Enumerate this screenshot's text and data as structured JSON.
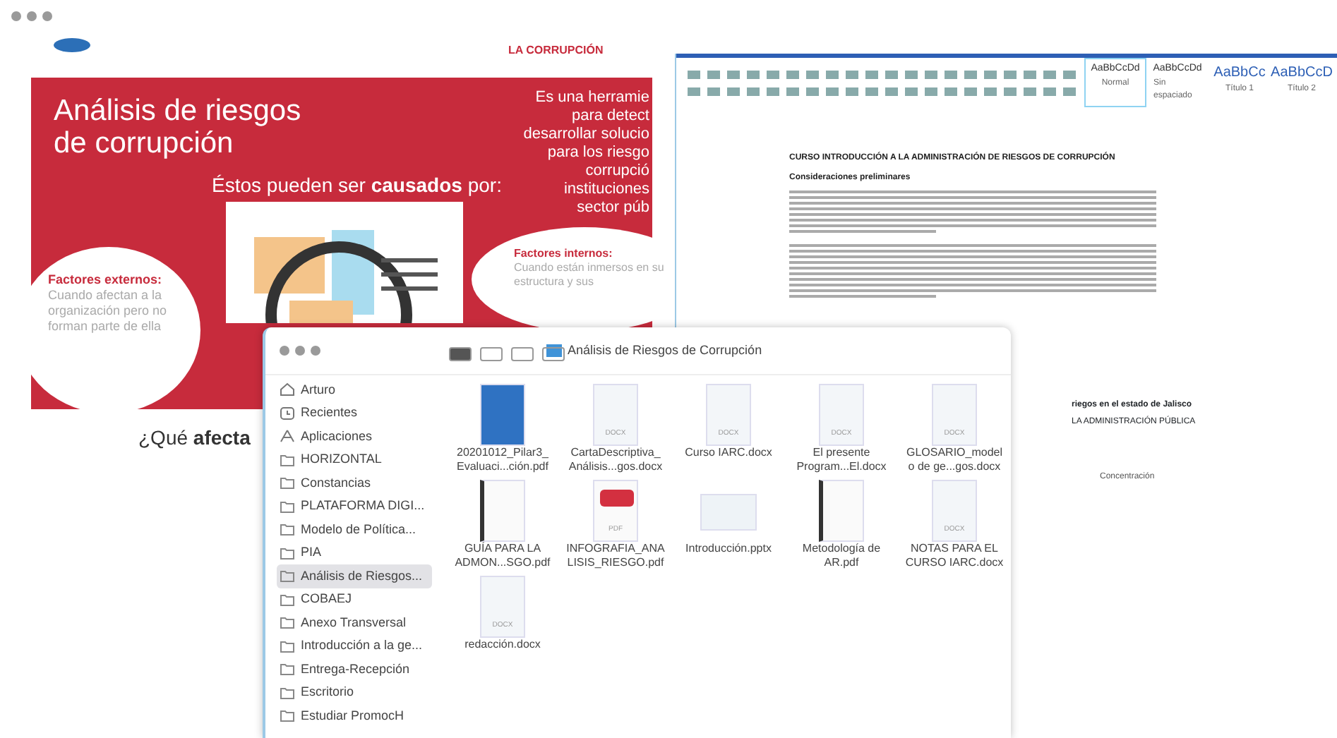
{
  "pdf_viewer": {
    "header_brand": "LA CORRUPCIÓN",
    "slide": {
      "title_lines": [
        "Análisis de riesgos",
        "de corrupción"
      ],
      "subtitle": "Éstos pueden ser **causados** por:",
      "side_text_lines": [
        "Es una herramie",
        "para detect",
        "desarrollar solucio",
        "para los riesgo",
        "corrupció",
        "instituciones",
        "sector púb"
      ],
      "bubbles": [
        {
          "heading": "Factores externos:",
          "body": "Cuando afectan a la organización pero no forman parte de ella"
        },
        {
          "heading": "Factores internos:",
          "body": "Cuando están inmersos en su estructura y sus"
        }
      ]
    },
    "next_heading": "¿Qué **afecta**"
  },
  "word": {
    "styles": [
      {
        "sample": "AaBbCcDd",
        "name": "Normal",
        "selected": true
      },
      {
        "sample": "AaBbCcDd",
        "name": "Sin espaciado",
        "selected": false
      },
      {
        "sample": "AaBbCc",
        "name": "Título 1",
        "selected": false
      },
      {
        "sample": "AaBbCcD",
        "name": "Título 2",
        "selected": false
      }
    ],
    "document": {
      "title": "CURSO INTRODUCCIÓN A LA ADMINISTRACIÓN DE RIESGOS DE CORRUPCIÓN",
      "section": "Consideraciones preliminares",
      "lower_heading": "riegos en el estado de Jalisco",
      "lower_line": "LA ADMINISTRACIÓN PÚBLICA"
    },
    "status": "Concentración"
  },
  "finder": {
    "title": "Análisis de Riesgos de Corrupción",
    "sidebar": [
      {
        "label": "Arturo",
        "kind": "home",
        "selected": false
      },
      {
        "label": "Recientes",
        "kind": "recent",
        "selected": false
      },
      {
        "label": "Aplicaciones",
        "kind": "apps",
        "selected": false
      },
      {
        "label": "HORIZONTAL",
        "kind": "folder",
        "selected": false
      },
      {
        "label": "Constancias",
        "kind": "folder",
        "selected": false
      },
      {
        "label": "PLATAFORMA DIGI...",
        "kind": "folder",
        "selected": false
      },
      {
        "label": "Modelo de Política...",
        "kind": "folder",
        "selected": false
      },
      {
        "label": "PIA",
        "kind": "folder",
        "selected": false
      },
      {
        "label": "Análisis de Riesgos...",
        "kind": "folder",
        "selected": true
      },
      {
        "label": "COBAEJ",
        "kind": "folder",
        "selected": false
      },
      {
        "label": "Anexo Transversal",
        "kind": "folder",
        "selected": false
      },
      {
        "label": "Introducción a la ge...",
        "kind": "folder",
        "selected": false
      },
      {
        "label": "Entrega-Recepción",
        "kind": "folder",
        "selected": false
      },
      {
        "label": "Escritorio",
        "kind": "folder",
        "selected": false
      },
      {
        "label": "Estudiar PromocH",
        "kind": "folder",
        "selected": false
      }
    ],
    "files": [
      {
        "name": [
          "20201012_Pilar3_",
          "Evaluaci...ción.pdf"
        ],
        "kind": "pdf-blue"
      },
      {
        "name": [
          "CartaDescriptiva_",
          "Análisis...gos.docx"
        ],
        "kind": "docx",
        "badge": "DOCX"
      },
      {
        "name": [
          "Curso IARC.docx"
        ],
        "kind": "docx",
        "badge": "DOCX"
      },
      {
        "name": [
          "El presente",
          "Program...El.docx"
        ],
        "kind": "docx",
        "badge": "DOCX"
      },
      {
        "name": [
          "GLOSARIO_model",
          "o de ge...gos.docx"
        ],
        "kind": "docx",
        "badge": "DOCX"
      },
      {
        "name": [
          "GUÍA PARA LA",
          "ADMON...SGO.pdf"
        ],
        "kind": "pdf"
      },
      {
        "name": [
          "INFOGRAFIA_ANA",
          "LISIS_RIESGO.pdf"
        ],
        "kind": "pdf-red",
        "badge": "PDF"
      },
      {
        "name": [
          "Introducción.pptx"
        ],
        "kind": "pptx"
      },
      {
        "name": [
          "Metodología de",
          "AR.pdf"
        ],
        "kind": "pdf"
      },
      {
        "name": [
          "NOTAS PARA EL",
          "CURSO IARC.docx"
        ],
        "kind": "docx",
        "badge": "DOCX"
      },
      {
        "name": [
          "redacción.docx"
        ],
        "kind": "docx",
        "badge": "DOCX"
      }
    ]
  }
}
